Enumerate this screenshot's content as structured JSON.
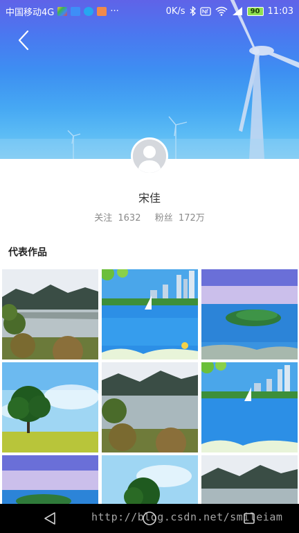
{
  "status_bar": {
    "carrier": "中国移动4G",
    "more": "···",
    "speed": "0K/s",
    "battery": "90",
    "time": "11:03",
    "icons": [
      "app-icon-photos",
      "app-icon-mail",
      "app-icon-message",
      "app-icon-gallery",
      "bluetooth-icon",
      "nfc-icon",
      "wifi-icon",
      "signal-icon",
      "battery-icon"
    ],
    "text_color": "#ffffff"
  },
  "header": {
    "back_icon": "chevron-left-icon",
    "colors": {
      "sky_top": "#5f63e8",
      "sky_bottom": "#7ccaf3"
    }
  },
  "profile": {
    "name": "宋佳",
    "following_label": "关注",
    "following_count": "1632",
    "followers_label": "粉丝",
    "followers_count": "172万",
    "avatar_icon": "default-user-avatar-icon"
  },
  "works": {
    "title": "代表作品",
    "tiles": [
      "lake-mountains",
      "city-lake-sailboat",
      "island-sea",
      "tree-field",
      "lake-mountains",
      "city-lake-sailboat",
      "island-sea",
      "tree-field",
      "lake-mountains"
    ]
  },
  "nav": {
    "icons": [
      "back-triangle-icon",
      "home-circle-icon",
      "recent-square-icon"
    ]
  },
  "watermark": "http://blog.csdn.net/smileiam"
}
